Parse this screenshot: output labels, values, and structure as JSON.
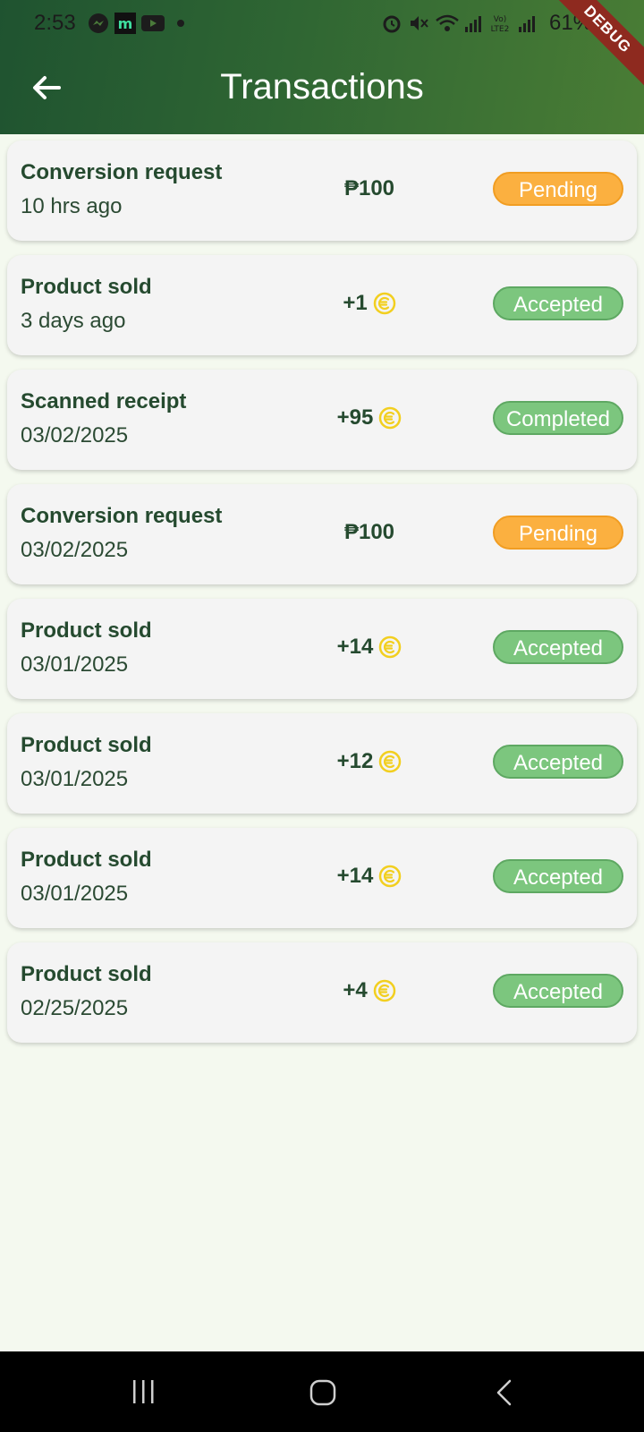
{
  "status_bar": {
    "time": "2:53",
    "battery": "61%",
    "icons": [
      "messenger-icon",
      "m-app-icon",
      "youtube-icon",
      "dot-icon",
      "alarm-icon",
      "mute-icon",
      "wifi-icon",
      "signal-icon",
      "volte-icon",
      "signal-icon"
    ]
  },
  "debug_banner": "DEBUG",
  "header": {
    "title": "Transactions",
    "back_icon": "arrow-left-icon"
  },
  "colors": {
    "appbar_start": "#1f5330",
    "appbar_end": "#4a7d35",
    "pending": "#fbb040",
    "accepted": "#7cc67e",
    "coin": "#f2cf1f"
  },
  "transactions": [
    {
      "name": "Conversion request",
      "date": "10 hrs ago",
      "amount": "₱100",
      "coin": false,
      "status": "Pending",
      "status_type": "pending"
    },
    {
      "name": "Product sold",
      "date": "3 days ago",
      "amount": "+1",
      "coin": true,
      "status": "Accepted",
      "status_type": "accepted"
    },
    {
      "name": "Scanned receipt",
      "date": "03/02/2025",
      "amount": "+95",
      "coin": true,
      "status": "Completed",
      "status_type": "completed"
    },
    {
      "name": "Conversion request",
      "date": "03/02/2025",
      "amount": "₱100",
      "coin": false,
      "status": "Pending",
      "status_type": "pending"
    },
    {
      "name": "Product sold",
      "date": "03/01/2025",
      "amount": "+14",
      "coin": true,
      "status": "Accepted",
      "status_type": "accepted"
    },
    {
      "name": "Product sold",
      "date": "03/01/2025",
      "amount": "+12",
      "coin": true,
      "status": "Accepted",
      "status_type": "accepted"
    },
    {
      "name": "Product sold",
      "date": "03/01/2025",
      "amount": "+14",
      "coin": true,
      "status": "Accepted",
      "status_type": "accepted"
    },
    {
      "name": "Product sold",
      "date": "02/25/2025",
      "amount": "+4",
      "coin": true,
      "status": "Accepted",
      "status_type": "accepted"
    }
  ],
  "nav": {
    "recents_icon": "recents-icon",
    "home_icon": "home-icon",
    "back_icon": "nav-back-icon"
  }
}
